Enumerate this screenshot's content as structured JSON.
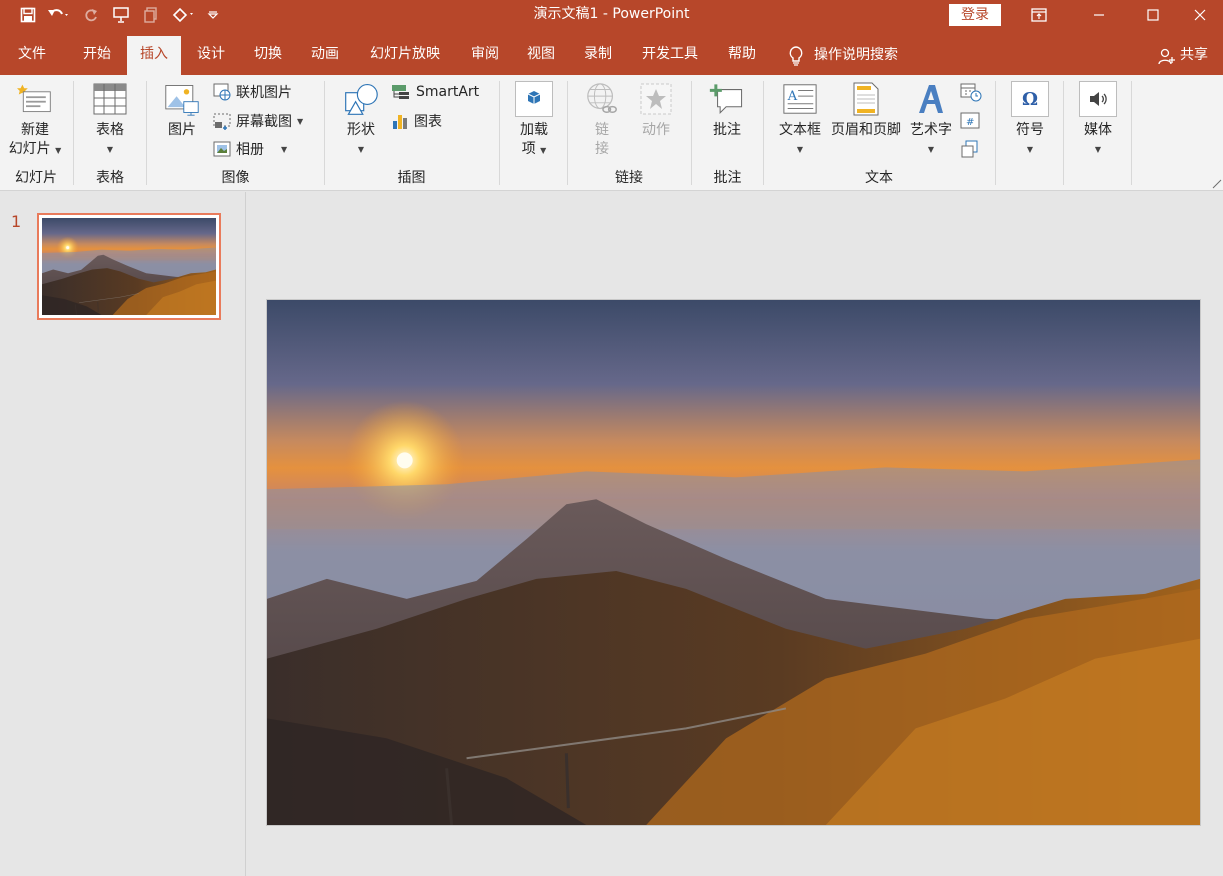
{
  "app": {
    "title": "演示文稿1  -  PowerPoint",
    "login_label": "登录",
    "accent_color": "#b7472a"
  },
  "qat": [
    "save-icon",
    "undo-icon",
    "redo-icon",
    "present-icon",
    "copy-format-icon",
    "touch-mode-icon",
    "customize-icon"
  ],
  "tabs": [
    {
      "label": "文件"
    },
    {
      "label": "开始"
    },
    {
      "label": "插入",
      "active": true
    },
    {
      "label": "设计"
    },
    {
      "label": "切换"
    },
    {
      "label": "动画"
    },
    {
      "label": "幻灯片放映"
    },
    {
      "label": "审阅"
    },
    {
      "label": "视图"
    },
    {
      "label": "录制"
    },
    {
      "label": "开发工具"
    },
    {
      "label": "帮助"
    }
  ],
  "search_label": "操作说明搜索",
  "share_label": "共享",
  "ribbon": {
    "groups": {
      "slides": "幻灯片",
      "tables": "表格",
      "images": "图像",
      "illustrations": "插图",
      "links": "链接",
      "comments": "批注",
      "text": "文本"
    },
    "new_slide_1": "新建",
    "new_slide_2": "幻灯片",
    "table": "表格",
    "picture": "图片",
    "online_pictures": "联机图片",
    "screenshot": "屏幕截图",
    "album": "相册",
    "shapes": "形状",
    "smartart": "SmartArt",
    "chart": "图表",
    "addins_1": "加载",
    "addins_2": "项",
    "link_1": "链",
    "link_2": "接",
    "action": "动作",
    "comment": "批注",
    "textbox": "文本框",
    "header_footer": "页眉和页脚",
    "wordart": "艺术字",
    "symbols": "符号",
    "media": "媒体"
  },
  "slides": [
    {
      "number": "1"
    }
  ]
}
